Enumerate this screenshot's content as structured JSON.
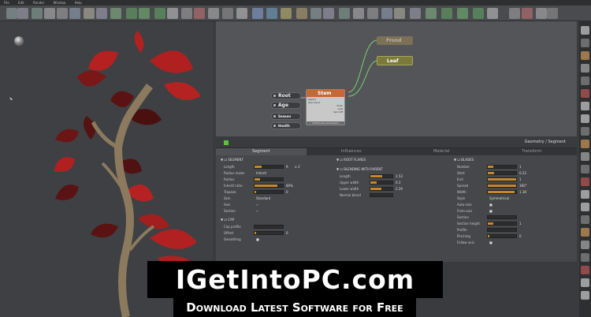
{
  "menu": [
    "File",
    "Edit",
    "Render",
    "Window",
    "Help"
  ],
  "nodes": {
    "root": "Root",
    "age": "Age",
    "season": "Season",
    "health": "Health",
    "stem": "Stem",
    "stem_sub": [
      "Age(1)",
      "Spin Input"
    ],
    "stem_ports": [
      "Ports",
      "Leaf",
      "Spin Off",
      "Additional parameters"
    ],
    "frond": "Frond",
    "leaf": "Leaf"
  },
  "prop_header": {
    "breadcrumb": "Geometry / Segment"
  },
  "tabs": [
    "Segment",
    "Influences",
    "Material",
    "Transform"
  ],
  "segment": {
    "title": "SEGMENT",
    "rows": [
      {
        "label": "Length",
        "value": "9",
        "extra": "± 2",
        "fill": 0.25
      },
      {
        "label": "Radius mode",
        "value": "Inherit",
        "fill": 0
      },
      {
        "label": "Radius",
        "value": "",
        "fill": 0.2
      },
      {
        "label": "Inherit ratio",
        "value": "80%",
        "fill": 0.8
      },
      {
        "label": "Trapeze",
        "value": "0",
        "fill": 0.05
      },
      {
        "label": "Skin",
        "value": "Standard",
        "fill": 0
      },
      {
        "label": "Axis",
        "value": "✓",
        "fill": 0
      },
      {
        "label": "Section",
        "value": "✓",
        "fill": 0
      }
    ]
  },
  "cap": {
    "title": "CAP",
    "rows": [
      {
        "label": "Cap profile",
        "value": "",
        "fill": 0
      },
      {
        "label": "Offset",
        "value": "0",
        "fill": 0.05
      },
      {
        "label": "Smoothing",
        "value": "■",
        "fill": 0
      }
    ]
  },
  "root_flares": {
    "title": "ROOT FLARES"
  },
  "blending": {
    "title": "BLENDING WITH PARENT",
    "rows": [
      {
        "label": "Length",
        "value": "2.53",
        "fill": 0.55
      },
      {
        "label": "Upper width",
        "value": "0.3",
        "fill": 0.3
      },
      {
        "label": "Lower width",
        "value": "2.29",
        "fill": 0.5
      },
      {
        "label": "Normal blend",
        "value": "",
        "fill": 0
      }
    ]
  },
  "blades": {
    "title": "BLADES",
    "rows": [
      {
        "label": "Number",
        "value": "1",
        "fill": 0.2
      },
      {
        "label": "Start",
        "value": "0.22",
        "fill": 0.22
      },
      {
        "label": "End",
        "value": "1",
        "fill": 1
      },
      {
        "label": "Spread",
        "value": "360°",
        "fill": 1
      },
      {
        "label": "Width",
        "value": "1.38",
        "fill": 0.95
      },
      {
        "label": "Style",
        "value": "Symmetrical",
        "fill": 0
      },
      {
        "label": "Auto-size",
        "value": "■",
        "fill": 0
      },
      {
        "label": "From axis",
        "value": "■",
        "fill": 0
      },
      {
        "label": "Section",
        "value": "",
        "fill": 0
      },
      {
        "label": "Section height",
        "value": "1",
        "fill": 0.2
      },
      {
        "label": "Profile",
        "value": "",
        "fill": 0
      },
      {
        "label": "Pinching",
        "value": "0",
        "fill": 0.05
      },
      {
        "label": "Follow axis",
        "value": "■",
        "fill": 0
      }
    ]
  },
  "banner": {
    "main": "IGetIntoPC.com",
    "sub": "Download Latest Software for Free"
  }
}
